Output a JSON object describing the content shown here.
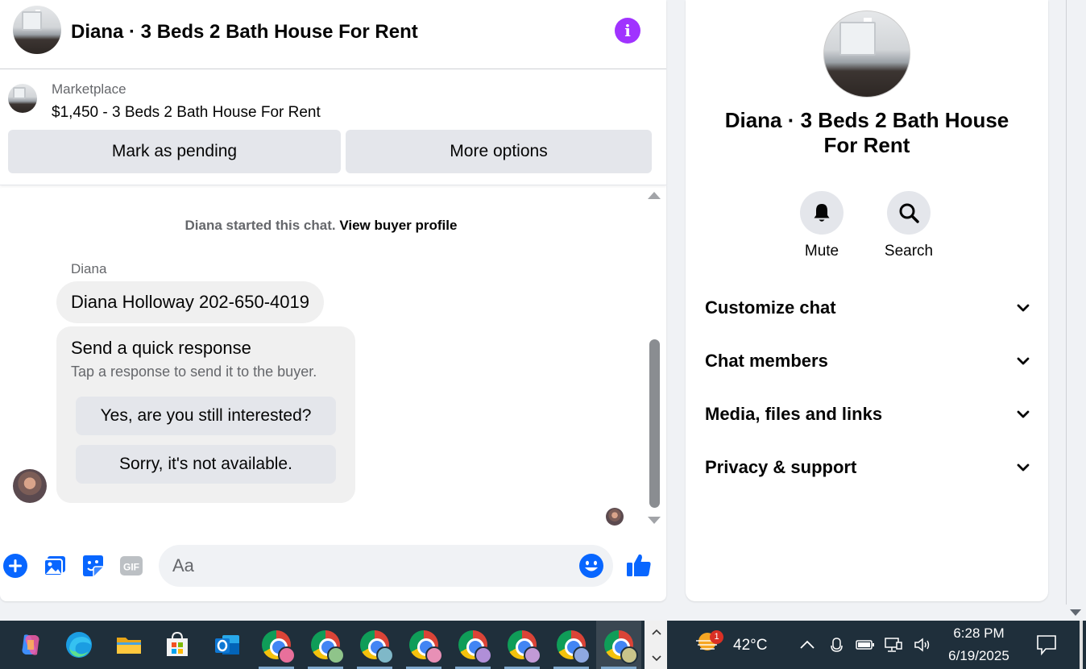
{
  "chat": {
    "title": "Diana · 3 Beds 2 Bath House For Rent",
    "info_label": "i",
    "listing": {
      "source": "Marketplace",
      "title": "$1,450 - 3 Beds 2 Bath House For Rent"
    },
    "actions": {
      "pending": "Mark as pending",
      "options": "More options"
    },
    "started": {
      "text": "Diana started this chat.",
      "link": "View buyer profile"
    },
    "sender_name": "Diana",
    "message": "Diana Holloway 202-650-4019",
    "quick": {
      "title": "Send a quick response",
      "subtitle": "Tap a response to send it to the buyer.",
      "reply_yes": "Yes, are you still interested?",
      "reply_sorry": "Sorry, it's not available."
    },
    "composer": {
      "placeholder": "Aa"
    }
  },
  "details": {
    "title": "Diana · 3 Beds 2 Bath House For Rent",
    "mute_label": "Mute",
    "search_label": "Search",
    "sections": {
      "customize": "Customize chat",
      "members": "Chat members",
      "media": "Media, files and links",
      "privacy": "Privacy & support"
    }
  },
  "taskbar": {
    "weather_badge": "1",
    "weather_temp": "42°C",
    "time": "6:28 PM",
    "date": "6/19/2025"
  },
  "colors": {
    "accent": "#0866ff",
    "info": "#a033ff",
    "taskbar": "#1f2f3b"
  },
  "icons": [
    "info-icon",
    "plus-icon",
    "photo-icon",
    "sticker-icon",
    "gif-icon",
    "emoji-icon",
    "like-icon",
    "bell-icon",
    "search-icon",
    "chevron-down-icon"
  ]
}
